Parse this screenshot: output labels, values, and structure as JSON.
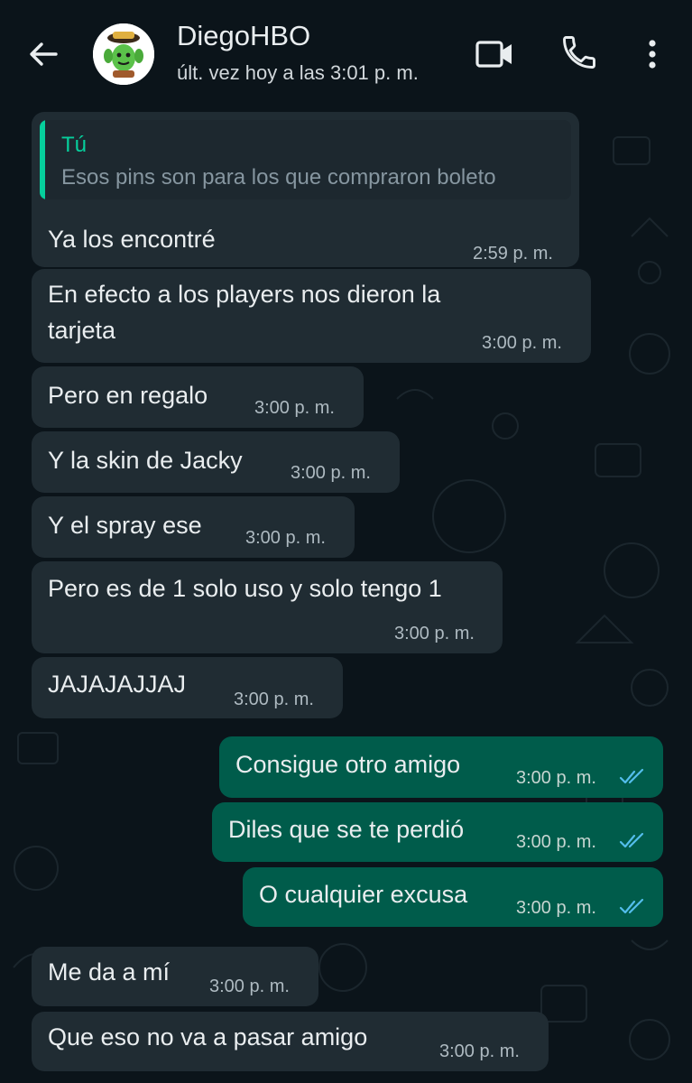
{
  "header": {
    "contact_name": "DiegoHBO",
    "last_seen": "últ. vez hoy a las 3:01 p. m.",
    "icons": [
      "back-arrow-icon",
      "video-call-icon",
      "phone-icon",
      "more-vert-icon"
    ]
  },
  "colors": {
    "background": "#0b141a",
    "incoming_bubble": "#202c33",
    "outgoing_bubble": "#005c4b",
    "read_ticks": "#53bdeb",
    "quote_accent": "#06cf9c"
  },
  "messages": [
    {
      "direction": "in",
      "quote": {
        "author": "Tú",
        "text": "Esos pins son para los que compraron boleto"
      },
      "text": "Ya los encontré",
      "time": "2:59 p. m."
    },
    {
      "direction": "in",
      "lines": [
        "En efecto a los players nos dieron la",
        "tarjeta"
      ],
      "time": "3:00 p. m."
    },
    {
      "direction": "in",
      "text": "Pero en regalo",
      "time": "3:00 p. m."
    },
    {
      "direction": "in",
      "text": "Y la skin de Jacky",
      "time": "3:00 p. m."
    },
    {
      "direction": "in",
      "text": "Y el spray ese",
      "time": "3:00 p. m."
    },
    {
      "direction": "in",
      "text": "Pero es de 1 solo uso y solo tengo 1",
      "time": "3:00 p. m."
    },
    {
      "direction": "in",
      "text": "JAJAJAJJAJ",
      "time": "3:00 p. m."
    },
    {
      "direction": "out",
      "text": "Consigue otro amigo",
      "time": "3:00 p. m.",
      "status": "read"
    },
    {
      "direction": "out",
      "text": "Diles que se te perdió",
      "time": "3:00 p. m.",
      "status": "read"
    },
    {
      "direction": "out",
      "text": "O cualquier excusa",
      "time": "3:00 p. m.",
      "status": "read"
    },
    {
      "direction": "in",
      "text": "Me da a mí",
      "time": "3:00 p. m."
    },
    {
      "direction": "in",
      "text": "Que eso no va a pasar amigo",
      "time": "3:00 p. m."
    }
  ]
}
